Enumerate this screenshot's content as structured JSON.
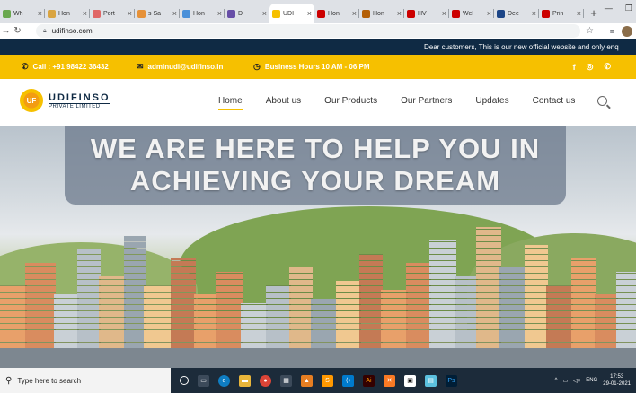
{
  "browser": {
    "tabs": [
      {
        "label": "Wh",
        "color": "#6aa84f"
      },
      {
        "label": "Hon",
        "color": "#d9a441"
      },
      {
        "label": "Port",
        "color": "#e06666"
      },
      {
        "label": "s Sa",
        "color": "#e69138"
      },
      {
        "label": "Hon",
        "color": "#4a90d9"
      },
      {
        "label": "D",
        "color": "#674ea7"
      },
      {
        "label": "UDI",
        "color": "#f6c000"
      },
      {
        "label": "Hon",
        "color": "#cc0000"
      },
      {
        "label": "Hon",
        "color": "#b45f06"
      },
      {
        "label": "HV",
        "color": "#cc0000"
      },
      {
        "label": "Wel",
        "color": "#cc0000"
      },
      {
        "label": "Dee",
        "color": "#1c4587"
      },
      {
        "label": "Prin",
        "color": "#cc0000"
      }
    ],
    "new_tab": "+",
    "url": "udifinso.com"
  },
  "marquee": "Dear customers, This is our new official website and only enq",
  "infobar": {
    "call": "Call : +91 98422 36432",
    "email": "adminudi@udifinso.in",
    "hours": "Business Hours 10 AM - 06 PM"
  },
  "logo": {
    "badge": "UF",
    "name": "UDIFINSO",
    "sub": "PRIVATE LIMITED"
  },
  "menu": [
    "Home",
    "About us",
    "Our Products",
    "Our Partners",
    "Updates",
    "Contact us"
  ],
  "hero": {
    "line1": "WE ARE HERE TO HELP YOU IN",
    "line2": "ACHIEVING YOUR DREAM"
  },
  "taskbar": {
    "search_placeholder": "Type here to search",
    "lang": "ENG",
    "time": "17:53",
    "date": "29-01-2021"
  },
  "colors": {
    "accent": "#f6c000",
    "navy": "#0f2a44"
  }
}
